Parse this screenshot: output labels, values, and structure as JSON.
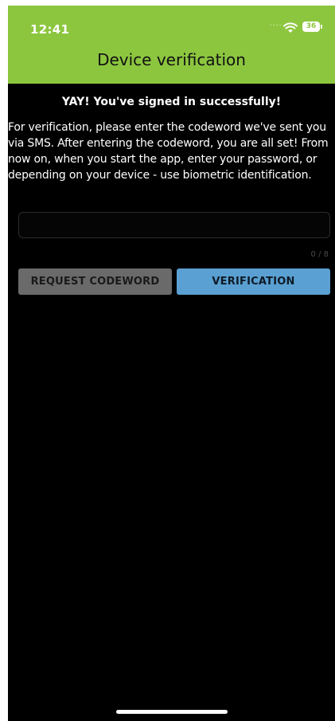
{
  "status_bar": {
    "time": "12:41",
    "signal": "....",
    "battery": "36"
  },
  "header": {
    "title": "Device verification"
  },
  "main": {
    "success_title": "YAY! You've signed in successfully!",
    "instructions": "For verification, please enter the codeword we've sent you via SMS.  After entering the codeword, you are all set! From now on, when you start the app, enter your password, or depending on your device - use biometric identification.",
    "codeword_input": {
      "value": "",
      "placeholder": ""
    },
    "char_counter": "0 / 8",
    "request_button_label": "REQUEST CODEWORD",
    "verify_button_label": "VERIFICATION"
  },
  "colors": {
    "header_green": "#8cc63f",
    "background": "#000000",
    "request_button": "#6a6a6a",
    "verify_button": "#5aa0d2"
  },
  "icons": {
    "wifi": "wifi-icon",
    "battery": "battery-icon"
  }
}
